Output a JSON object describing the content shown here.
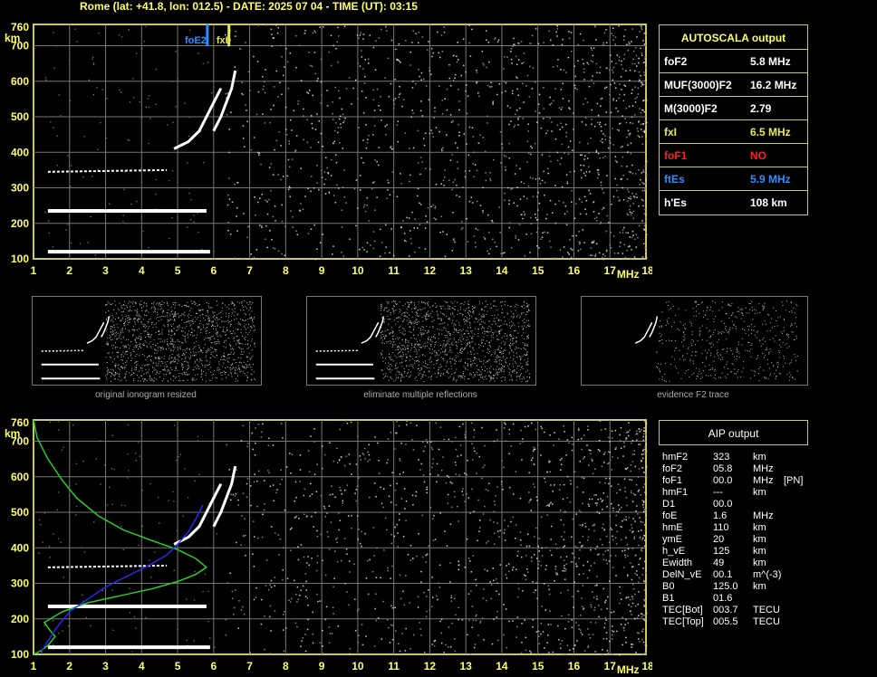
{
  "header": "Rome (lat: +41.8, lon: 012.5) - DATE: 2025 07 04 - TIME (UT): 03:15",
  "autoscala": {
    "title": "AUTOSCALA output",
    "rows": [
      {
        "label": "foF2",
        "value": "5.8 MHz",
        "color": "#ffffff"
      },
      {
        "label": "MUF(3000)F2",
        "value": "16.2 MHz",
        "color": "#ffffff"
      },
      {
        "label": "M(3000)F2",
        "value": "2.79",
        "color": "#ffffff"
      },
      {
        "label": "fxI",
        "value": "6.5 MHz",
        "color": "#e8e860"
      },
      {
        "label": "foF1",
        "value": "NO",
        "color": "#ff2020"
      },
      {
        "label": "ftEs",
        "value": "5.9 MHz",
        "color": "#2f8fff"
      },
      {
        "label": "h'Es",
        "value": "108    km",
        "color": "#ffffff"
      }
    ]
  },
  "thumbnails": [
    {
      "caption": "original ionogram resized"
    },
    {
      "caption": "eliminate multiple reflections"
    },
    {
      "caption": "evidence F2 trace"
    }
  ],
  "aip": {
    "title": "AIP output",
    "rows": [
      {
        "k": "hmF2",
        "v": "323",
        "u": "km",
        "x": ""
      },
      {
        "k": "foF2",
        "v": "05.8",
        "u": "MHz",
        "x": ""
      },
      {
        "k": "foF1",
        "v": "00.0",
        "u": "MHz",
        "x": "[PN]"
      },
      {
        "k": "hmF1",
        "v": "---",
        "u": "km",
        "x": ""
      },
      {
        "k": "D1",
        "v": "00.0",
        "u": "",
        "x": ""
      },
      {
        "k": "foE",
        "v": "1.6",
        "u": "MHz",
        "x": ""
      },
      {
        "k": "hmE",
        "v": "110",
        "u": "km",
        "x": ""
      },
      {
        "k": "ymE",
        "v": "20",
        "u": "km",
        "x": ""
      },
      {
        "k": "h_vE",
        "v": "125",
        "u": "km",
        "x": ""
      },
      {
        "k": "Ewidth",
        "v": "49",
        "u": "km",
        "x": ""
      },
      {
        "k": "DelN_vE",
        "v": "00.1",
        "u": "m^(-3)",
        "x": ""
      },
      {
        "k": "B0",
        "v": "125.0",
        "u": "km",
        "x": ""
      },
      {
        "k": "B1",
        "v": "01.6",
        "u": "",
        "x": ""
      },
      {
        "k": "TEC[Bot]",
        "v": "003.7",
        "u": "TECU",
        "x": ""
      },
      {
        "k": "TEC[Top]",
        "v": "005.5",
        "u": "TECU",
        "x": ""
      }
    ]
  },
  "colors": {
    "frame": "#c8c86a",
    "grid": "#777777",
    "tick": "#ffff66",
    "profile": "#22dd22",
    "trace": "#2a2aff",
    "echo": "#ffffff"
  },
  "chart_data": [
    {
      "type": "scatter",
      "title": "",
      "xlabel": "MHz",
      "ylabel": "km",
      "xlim": [
        1,
        18
      ],
      "ylim": [
        100,
        760
      ],
      "x_ticks": [
        1,
        2,
        3,
        4,
        5,
        6,
        7,
        8,
        9,
        10,
        11,
        12,
        13,
        14,
        15,
        16,
        17,
        18
      ],
      "y_ticks": [
        100,
        200,
        300,
        400,
        500,
        600,
        700,
        760
      ],
      "markers": [
        {
          "label": "foE2",
          "x": 5.9,
          "color": "#2f8fff"
        },
        {
          "label": "fxI",
          "x": 6.5,
          "color": "#e8e860"
        }
      ],
      "echo_traces": [
        {
          "name": "Es",
          "x": [
            1.4,
            5.9
          ],
          "y": [
            120,
            120
          ]
        },
        {
          "name": "Es multiple",
          "x": [
            1.4,
            5.8
          ],
          "y": [
            235,
            235
          ]
        },
        {
          "name": "F lower",
          "x": [
            1.4,
            4.7
          ],
          "y": [
            345,
            350
          ]
        },
        {
          "name": "F2 O-trace",
          "x": [
            4.9,
            5.3,
            5.6,
            5.8,
            6.0,
            6.2
          ],
          "y": [
            410,
            430,
            460,
            500,
            540,
            580
          ]
        },
        {
          "name": "F2 X-trace",
          "x": [
            6.0,
            6.2,
            6.35,
            6.5,
            6.6
          ],
          "y": [
            460,
            500,
            540,
            580,
            630
          ]
        }
      ]
    },
    {
      "type": "line",
      "title": "",
      "xlabel": "MHz",
      "ylabel": "km",
      "xlim": [
        1,
        18
      ],
      "ylim": [
        100,
        760
      ],
      "x_ticks": [
        1,
        2,
        3,
        4,
        5,
        6,
        7,
        8,
        9,
        10,
        11,
        12,
        13,
        14,
        15,
        16,
        17,
        18
      ],
      "y_ticks": [
        100,
        200,
        300,
        400,
        500,
        600,
        700,
        760
      ],
      "series": [
        {
          "color": "#22dd22",
          "x": [
            1.0,
            1.2,
            1.4,
            1.6,
            1.4,
            1.3,
            1.8,
            2.5,
            3.4,
            4.3,
            5.0,
            5.5,
            5.8,
            5.5,
            5.0,
            4.3,
            3.5,
            2.8,
            2.2,
            1.8,
            1.4,
            1.1,
            1.0
          ],
          "y": [
            100,
            110,
            125,
            150,
            175,
            190,
            220,
            245,
            265,
            285,
            305,
            325,
            345,
            370,
            395,
            420,
            450,
            490,
            540,
            590,
            650,
            710,
            760
          ]
        },
        {
          "color": "#2a2aff",
          "x": [
            1.2,
            1.6,
            2.0,
            2.5,
            3.0,
            3.6,
            4.2,
            4.7,
            5.0,
            5.3,
            5.5,
            5.7
          ],
          "y": [
            105,
            170,
            220,
            255,
            290,
            320,
            350,
            380,
            410,
            445,
            480,
            520
          ]
        }
      ],
      "echo_traces": [
        {
          "name": "Es",
          "x": [
            1.4,
            5.9
          ],
          "y": [
            120,
            120
          ]
        },
        {
          "name": "Es multiple",
          "x": [
            1.4,
            5.8
          ],
          "y": [
            235,
            235
          ]
        },
        {
          "name": "F lower",
          "x": [
            1.4,
            4.7
          ],
          "y": [
            345,
            350
          ]
        },
        {
          "name": "F2 O-trace",
          "x": [
            4.9,
            5.3,
            5.6,
            5.8,
            6.0,
            6.2
          ],
          "y": [
            410,
            430,
            460,
            500,
            540,
            580
          ]
        },
        {
          "name": "F2 X-trace",
          "x": [
            6.0,
            6.2,
            6.35,
            6.5,
            6.6
          ],
          "y": [
            460,
            500,
            540,
            580,
            630
          ]
        }
      ]
    }
  ]
}
